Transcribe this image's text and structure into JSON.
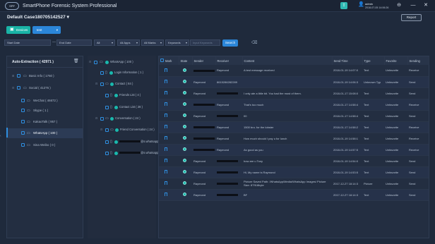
{
  "app": {
    "title": "SmartPhone Forensic System Professional",
    "logo_text": "SPF"
  },
  "user": {
    "name": "admin",
    "time": "2018-07-05 14:06:26"
  },
  "window_controls": [
    "⊖",
    "—",
    "✕"
  ],
  "case": {
    "title": "Default Case180705142527"
  },
  "toolbar": {
    "report_label": "Report",
    "devices_label": "Devices",
    "device_value": "test"
  },
  "filters": {
    "start_date": "Start Date",
    "end_date": "End Date",
    "category": "All",
    "apps": "All Apps",
    "marks": "All Marks",
    "field": "Keywords",
    "keyword_placeholder": "Input Keywords",
    "search_label": "Search"
  },
  "left_panel": {
    "header": "Auto-Extraction ( 42971 )",
    "items": [
      {
        "label": "Basic Info ( 1760 )"
      },
      {
        "label": "Social ( 41276 )"
      },
      {
        "label": "WeChat ( 46672 )"
      },
      {
        "label": "Skype ( 1 )"
      },
      {
        "label": "KakaoTalk ( 957 )"
      },
      {
        "label": "WhatsApp ( 100 )"
      },
      {
        "label": "Sina Weibo ( 0 )"
      }
    ]
  },
  "mid_panel": {
    "items": [
      {
        "label": "WhatsApp ( 100 )"
      },
      {
        "label": "Login Information ( 1 )"
      },
      {
        "label": "Contact ( 84 )"
      },
      {
        "label": "Friends List ( 4 )"
      },
      {
        "label": "Contact List ( 28 )"
      },
      {
        "label": "Conversation ( 24 )"
      },
      {
        "label": "Friend Conversation ( 24 )"
      },
      {
        "label": "@s.whatsapp.net(Luo"
      },
      {
        "label": "@s.whatsapp.net(Luo"
      }
    ]
  },
  "table": {
    "columns": [
      "Mark",
      "State",
      "Sender",
      "Receiver",
      "Content",
      "Send Time",
      "Type",
      "Favorite",
      "Sending"
    ],
    "rows": [
      {
        "sender": "",
        "receiver": "Raymond",
        "content": "A test message received",
        "time": "2018-01-19 14:07:0",
        "type": "Text",
        "favorite": "Unfavorite",
        "sending": "Receive"
      },
      {
        "sender": "Raymond",
        "receiver": "8615286282289",
        "content": "",
        "time": "2018-01-19 14:06:3",
        "type": "Unknown Typ",
        "favorite": "Unfavorite",
        "sending": "Send"
      },
      {
        "sender": "Raymond",
        "receiver": "",
        "content": "I only ate a little bit. You had the most of them.",
        "time": "2018-01-17 15:08:0",
        "type": "Text",
        "favorite": "Unfavorite",
        "sending": "Send"
      },
      {
        "sender": "",
        "receiver": "Raymond",
        "content": "That's too much",
        "time": "2018-01-17 14:58:4",
        "type": "Text",
        "favorite": "Unfavorite",
        "sending": "Receive"
      },
      {
        "sender": "Raymond",
        "receiver": "",
        "content": "00",
        "time": "2018-01-17 14:58:4",
        "type": "Text",
        "favorite": "Unfavorite",
        "sending": "Send"
      },
      {
        "sender": "",
        "receiver": "Raymond",
        "content": "1500 bro. for the lobster",
        "time": "2018-01-17 14:58:2",
        "type": "Text",
        "favorite": "Unfavorite",
        "sending": "Receive"
      },
      {
        "sender": "",
        "receiver": "Raymond",
        "content": "How much should I pay u for lunch",
        "time": "2018-01-19 14:58:1",
        "type": "Text",
        "favorite": "Unfavorite",
        "sending": "Receive"
      },
      {
        "sender": "",
        "receiver": "Raymond",
        "content": "As good as you",
        "time": "2018-01-19 14:57:5",
        "type": "Text",
        "favorite": "Unfavorite",
        "sending": "Receive"
      },
      {
        "sender": "Raymond",
        "receiver": "",
        "content": "how are u Tony",
        "time": "2018-01-19 14:54:0",
        "type": "Text",
        "favorite": "Unfavorite",
        "sending": "Send"
      },
      {
        "sender": "Raymond",
        "receiver": "",
        "content": "Hi, My name is Raymond",
        "time": "2018-01-19 14:53:5",
        "type": "Text",
        "favorite": "Unfavorite",
        "sending": "Send"
      },
      {
        "sender": "Raymond",
        "receiver": "",
        "content": "Picture Saved Path: /WhatsApp/Media/WhatsApp Images/ Picture Size: 87918byte",
        "time": "2017-12-27 18:14:3",
        "type": "Picture",
        "favorite": "Unfavorite",
        "sending": "Send"
      },
      {
        "sender": "Raymond",
        "receiver": "",
        "content": "BF",
        "time": "2017-12-27 18:14:3",
        "type": "Text",
        "favorite": "Unfavorite",
        "sending": "Send"
      }
    ]
  },
  "colors": {
    "accent_teal": "#19b3a6",
    "accent_blue": "#2b86d9",
    "bg": "#1f2a3c"
  }
}
